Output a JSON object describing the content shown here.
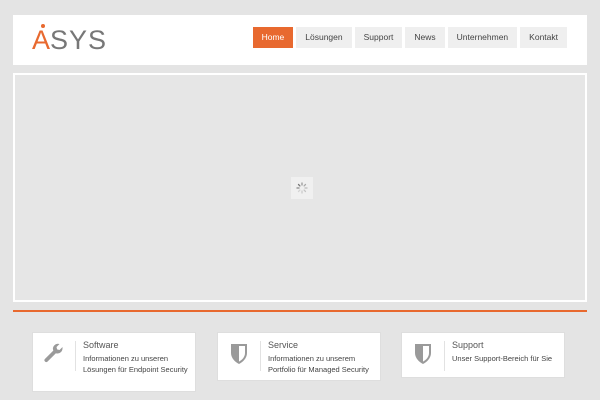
{
  "header": {
    "logo_a": "A",
    "logo_rest": "SYS",
    "nav": [
      {
        "label": "Home",
        "active": true
      },
      {
        "label": "Lösungen",
        "active": false
      },
      {
        "label": "Support",
        "active": false
      },
      {
        "label": "News",
        "active": false
      },
      {
        "label": "Unternehmen",
        "active": false
      },
      {
        "label": "Kontakt",
        "active": false
      }
    ]
  },
  "slider": {
    "loading_icon": "spinner-icon"
  },
  "features": [
    {
      "icon": "wrench-icon",
      "title": "Software",
      "text": "Informationen zu unseren Lösungen für Endpoint Security"
    },
    {
      "icon": "shield-icon",
      "title": "Service",
      "text": "Informationen zu unserem Portfolio für Managed Security"
    },
    {
      "icon": "shield-icon",
      "title": "Support",
      "text": "Unser Support-Bereich für Sie"
    }
  ],
  "colors": {
    "accent": "#e8692f",
    "background": "#e4e4e4"
  }
}
